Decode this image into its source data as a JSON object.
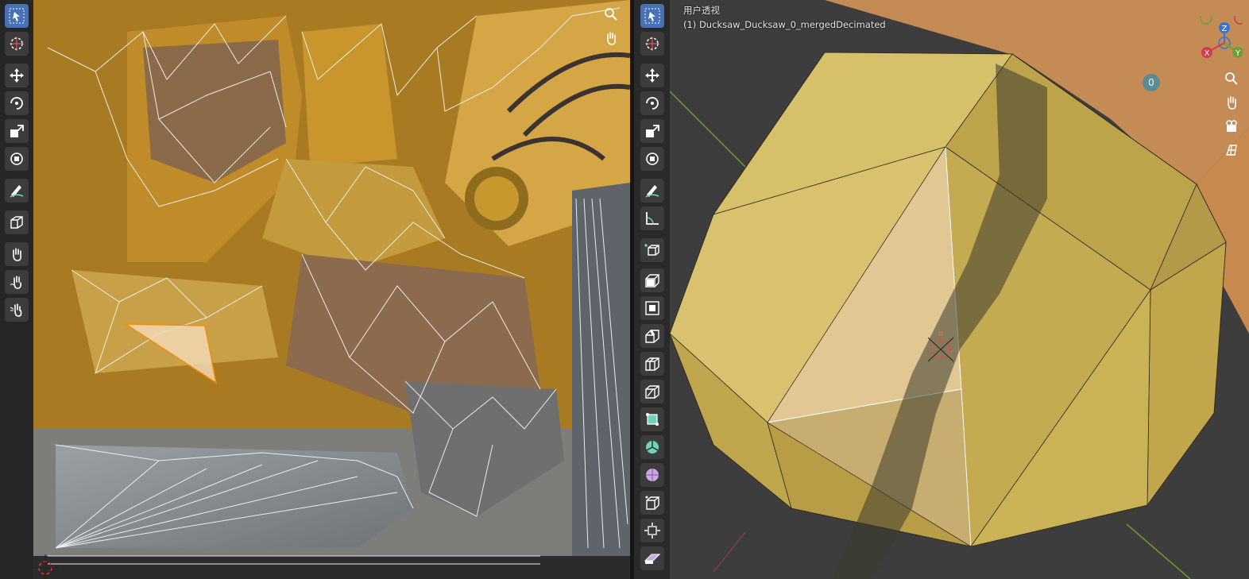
{
  "uv_editor": {
    "toolbar": [
      {
        "name": "select-tool",
        "icon": "select-box-icon",
        "active": true
      },
      {
        "name": "cursor-tool",
        "icon": "cursor-icon",
        "active": false
      },
      {
        "name": "move-tool",
        "icon": "move-icon",
        "active": false
      },
      {
        "name": "rotate-tool",
        "icon": "rotate-icon",
        "active": false
      },
      {
        "name": "scale-tool",
        "icon": "scale-icon",
        "active": false
      },
      {
        "name": "transform-tool",
        "icon": "transform-icon",
        "active": false
      },
      {
        "name": "annotate-tool",
        "icon": "annotate-icon",
        "active": false
      },
      {
        "name": "rip-region-tool",
        "icon": "rip-region-icon",
        "active": false
      },
      {
        "name": "grab-tool",
        "icon": "grab-icon",
        "active": false
      },
      {
        "name": "relax-tool",
        "icon": "relax-icon",
        "active": false
      },
      {
        "name": "pinch-tool",
        "icon": "pinch-icon",
        "active": false
      }
    ]
  },
  "viewport": {
    "view_name": "用户透视",
    "object_label": "(1) Ducksaw_Ducksaw_0_mergedDecimated",
    "counter": "0",
    "gizmo_axes": [
      "X",
      "Y",
      "Z"
    ],
    "toolbar": [
      {
        "name": "select-tool",
        "icon": "select-box-icon",
        "active": true
      },
      {
        "name": "cursor-tool",
        "icon": "cursor-icon",
        "active": false
      },
      {
        "name": "move-tool",
        "icon": "move-icon",
        "active": false
      },
      {
        "name": "rotate-tool",
        "icon": "rotate-icon",
        "active": false
      },
      {
        "name": "scale-tool",
        "icon": "scale-icon",
        "active": false
      },
      {
        "name": "transform-tool",
        "icon": "transform-icon",
        "active": false
      },
      {
        "name": "annotate-tool",
        "icon": "annotate-icon",
        "active": false
      },
      {
        "name": "measure-tool",
        "icon": "measure-icon",
        "active": false
      },
      {
        "name": "add-cube-tool",
        "icon": "add-cube-icon",
        "active": false
      },
      {
        "name": "extrude-tool",
        "icon": "extrude-icon",
        "active": false
      },
      {
        "name": "inset-tool",
        "icon": "inset-icon",
        "active": false
      },
      {
        "name": "bevel-tool",
        "icon": "bevel-icon",
        "active": false
      },
      {
        "name": "loop-cut-tool",
        "icon": "loop-cut-icon",
        "active": false
      },
      {
        "name": "knife-tool",
        "icon": "knife-icon",
        "active": false
      },
      {
        "name": "poly-build-tool",
        "icon": "poly-build-icon",
        "active": false
      },
      {
        "name": "spin-tool",
        "icon": "spin-icon",
        "active": false
      },
      {
        "name": "smooth-tool",
        "icon": "smooth-icon",
        "active": false
      },
      {
        "name": "edge-slide-tool",
        "icon": "edge-slide-icon",
        "active": false
      },
      {
        "name": "shrink-fatten-tool",
        "icon": "shrink-fatten-icon",
        "active": false
      },
      {
        "name": "shear-tool",
        "icon": "shear-icon",
        "active": false
      }
    ],
    "nav_buttons": [
      {
        "name": "zoom-button",
        "icon": "zoom-icon"
      },
      {
        "name": "pan-button",
        "icon": "hand-icon"
      },
      {
        "name": "camera-button",
        "icon": "camera-icon"
      },
      {
        "name": "ortho-button",
        "icon": "grid-icon"
      }
    ]
  }
}
